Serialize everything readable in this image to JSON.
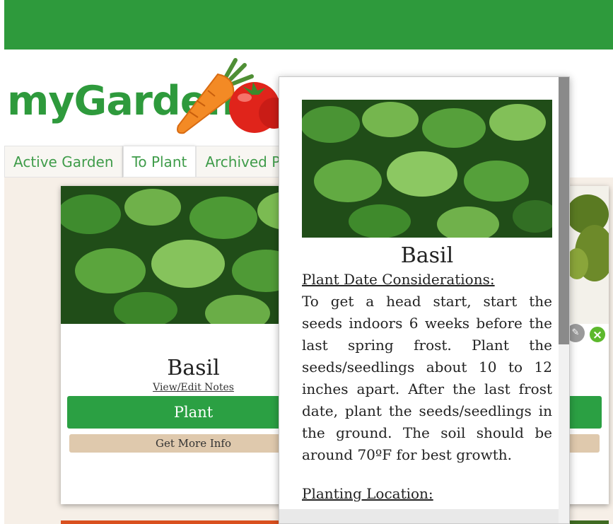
{
  "app": {
    "logo_text": "myGarden"
  },
  "tabs": [
    {
      "label": "Active Garden"
    },
    {
      "label": "To Plant"
    },
    {
      "label": "Archived Plan"
    }
  ],
  "cards": [
    {
      "title": "Basil",
      "notes_link": "View/Edit Notes",
      "plant_button": "Plant",
      "info_button": "Get More Info"
    }
  ],
  "modal": {
    "title": "Basil",
    "plant_date_heading": "Plant Date Considerations:",
    "plant_date_text": "To get a head start, start the seeds indoors 6 weeks before the last spring frost. Plant the seeds/seedlings about 10 to 12 inches apart. After the last frost date, plant the seeds/seedlings in the ground. The soil should be around 70ºF for best growth.",
    "location_heading": "Planting Location:"
  },
  "icons": {
    "edit": "pencil-icon",
    "confirm": "close-icon"
  },
  "colors": {
    "brand_green": "#2e9a3c",
    "button_green": "#2ba043",
    "info_tan": "#dfc9ad",
    "page_bg": "#f6efe7"
  }
}
